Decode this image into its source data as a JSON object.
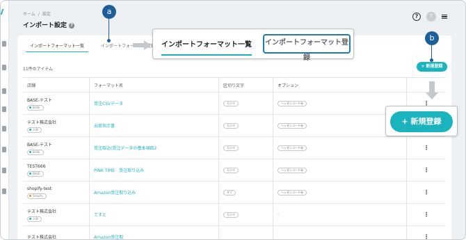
{
  "breadcrumb": [
    "ホーム",
    "/",
    "設定"
  ],
  "page_title": "インポート設定",
  "help_icon_label": "?",
  "avatar_initial": "T",
  "tabs": [
    {
      "label": "インポートフォーマット一覧",
      "active": true
    },
    {
      "label": "インポートフォーマット登録",
      "active": false
    }
  ],
  "zoom_tabs": {
    "list_label": "インポートフォーマット一覧",
    "register_label": "インポートフォーマット登録"
  },
  "callouts": {
    "a": "a",
    "b": "b"
  },
  "item_count": "11件のアイテム",
  "new_button": {
    "label": "+ 新規登録",
    "icon": "plus-icon"
  },
  "zoom_new_button": {
    "label": "+ 新規登録"
  },
  "table": {
    "headers": [
      "店舗",
      "フォーマット名",
      "区切り文字",
      "オプション"
    ],
    "rows": [
      {
        "store": "BASE-テスト",
        "badge": "BASE",
        "format": "受注CSVデータ",
        "delimiter": "カンマ",
        "option": "ヘッダレコード有",
        "badge_type": "base"
      },
      {
        "store": "テスト株式会社",
        "badge": "大原",
        "format": "出荷指示書",
        "delimiter": "カンマ",
        "option": "ヘッダレコード有",
        "badge_type": "base"
      },
      {
        "store": "BASE-テスト",
        "badge": "BASE",
        "format": "受注取込(受注データの基本項目2",
        "delimiter": "カンマ",
        "option": "ヘッダレコード有",
        "badge_type": "base"
      },
      {
        "store": "TEST666",
        "badge": "BASE",
        "format": "PINK TIME　受注取り込み",
        "delimiter": "カンマ",
        "option": "ヘッダレコード有",
        "badge_type": "base"
      },
      {
        "store": "shopify-test",
        "badge": "Shopify",
        "format": "Amazon受注取り込み",
        "delimiter": "タブ",
        "option": "ヘッダレコード有",
        "badge_type": "shopify"
      },
      {
        "store": "テスト株式会社",
        "badge": "大原",
        "format": "てすと",
        "delimiter": "カンマ",
        "option": "-",
        "badge_type": "base"
      },
      {
        "store": "テスト株式会社",
        "badge": "",
        "format": "Amazon受注取",
        "delimiter": "",
        "option": "",
        "badge_type": "base"
      }
    ]
  },
  "colors": {
    "accent": "#1bb3bd",
    "callout": "#1d5f9a"
  }
}
